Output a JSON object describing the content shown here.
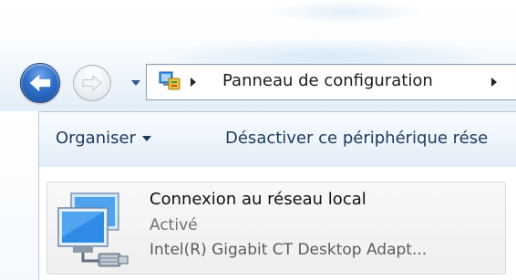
{
  "navigation": {
    "back_icon": "arrow-left-icon",
    "forward_icon": "arrow-right-icon",
    "history_icon": "chevron-down-icon"
  },
  "address_bar": {
    "location_icon": "control-panel-icon",
    "crumbs": [
      "Panneau de configuration"
    ]
  },
  "command_bar": {
    "organize_label": "Organiser",
    "disable_label": "Désactiver ce périphérique rése"
  },
  "connection": {
    "name": "Connexion au réseau local",
    "status": "Activé",
    "adapter": "Intel(R) Gigabit CT Desktop Adapt...",
    "icon": "network-connection-icon"
  }
}
